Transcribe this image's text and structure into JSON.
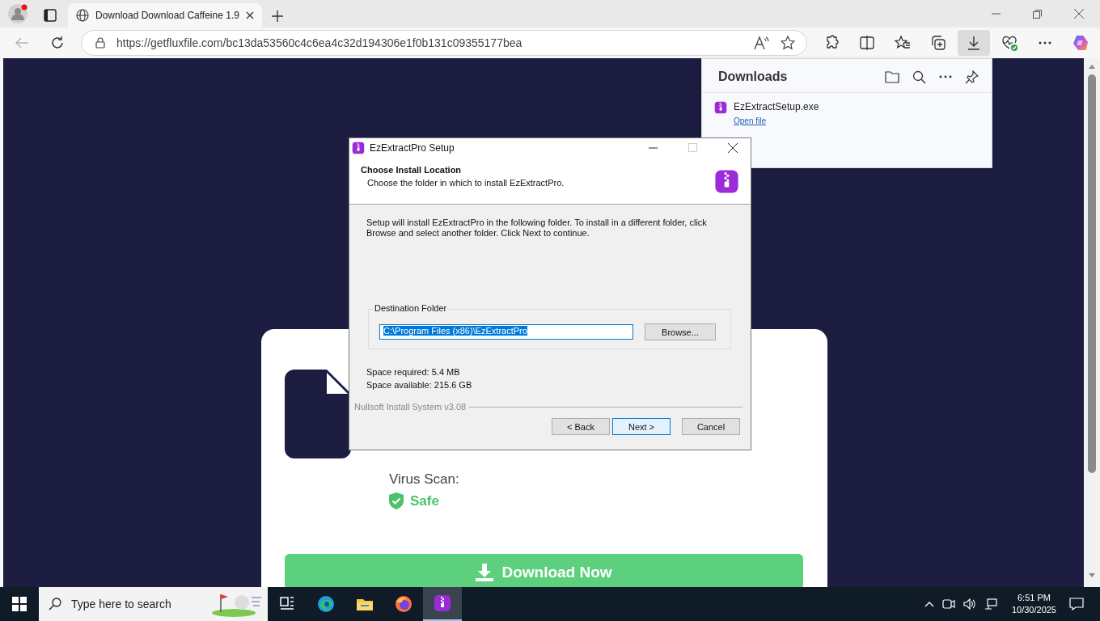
{
  "browser": {
    "tabs": [
      {
        "title": "Download Download Caffeine 1.9",
        "selected": true
      }
    ],
    "address": "https://getfluxfile.com/bc13da53560c4c6ea4c32d194306e1f0b131c09355177bea",
    "toolbar": [
      {
        "kind": "extensions",
        "selected": false
      },
      {
        "kind": "split",
        "selected": false
      },
      {
        "kind": "favorites",
        "selected": false
      },
      {
        "kind": "collections",
        "selected": false
      },
      {
        "kind": "downloads",
        "selected": true
      },
      {
        "kind": "health",
        "selected": false
      },
      {
        "kind": "more",
        "selected": false
      },
      {
        "kind": "copilot",
        "selected": false
      }
    ]
  },
  "downloads": {
    "title": "Downloads",
    "items": [
      {
        "file": "EzExtractSetup.exe",
        "action": "Open file"
      }
    ]
  },
  "page": {
    "virus_scan_label": "Virus Scan:",
    "status": "Safe",
    "download_button": "Download Now"
  },
  "dialog": {
    "title": "EzExtractPro Setup",
    "heading": "Choose Install Location",
    "subheading": "Choose the folder in which to install EzExtractPro.",
    "intro": "Setup will install EzExtractPro in the following folder. To install in a different folder, click Browse and select another folder. Click Next to continue.",
    "group_label": "Destination Folder",
    "path": "C:\\Program Files (x86)\\EzExtractPro",
    "path_selected": true,
    "browse": "Browse...",
    "space_required": "Space required: 5.4 MB",
    "space_available": "Space available: 215.6 GB",
    "branding": "Nullsoft Install System v3.08",
    "buttons": [
      {
        "label": "< Back",
        "selected": false
      },
      {
        "label": "Next >",
        "selected": true
      },
      {
        "label": "Cancel",
        "selected": false
      }
    ]
  },
  "taskbar": {
    "search_placeholder": "Type here to search",
    "apps": [
      {
        "kind": "taskview",
        "selected": false
      },
      {
        "kind": "edge",
        "selected": false
      },
      {
        "kind": "explorer",
        "selected": false
      },
      {
        "kind": "firefox",
        "selected": false
      },
      {
        "kind": "installer",
        "selected": true
      }
    ],
    "time": "6:51 PM",
    "date": "10/30/2025"
  }
}
